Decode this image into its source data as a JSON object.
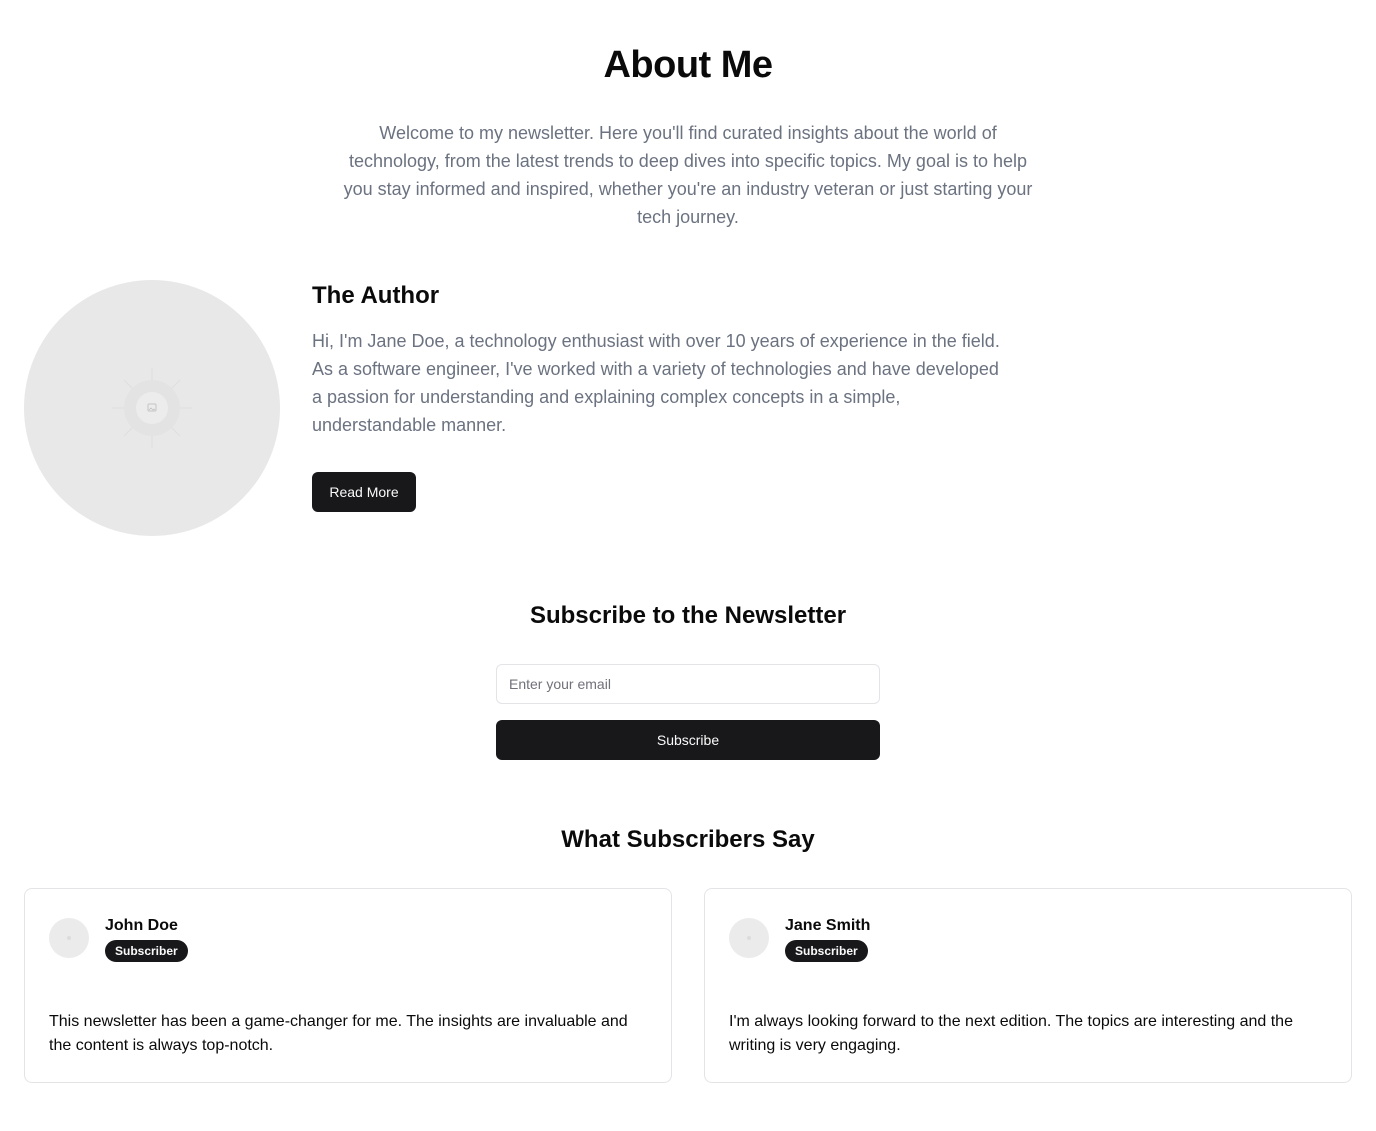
{
  "header": {
    "title": "About Me",
    "intro": "Welcome to my newsletter. Here you'll find curated insights about the world of technology, from the latest trends to deep dives into specific topics. My goal is to help you stay informed and inspired, whether you're an industry veteran or just starting your tech journey."
  },
  "author": {
    "heading": "The Author",
    "bio": "Hi, I'm Jane Doe, a technology enthusiast with over 10 years of experience in the field. As a software engineer, I've worked with a variety of technologies and have developed a passion for understanding and explaining complex concepts in a simple, understandable manner.",
    "read_more_label": "Read More",
    "avatar_icon": "image-placeholder-icon"
  },
  "subscribe": {
    "heading": "Subscribe to the Newsletter",
    "email_placeholder": "Enter your email",
    "email_value": "",
    "button_label": "Subscribe"
  },
  "testimonials": {
    "heading": "What Subscribers Say",
    "items": [
      {
        "name": "John Doe",
        "badge": "Subscriber",
        "quote": "This newsletter has been a game-changer for me. The insights are invaluable and the content is always top-notch."
      },
      {
        "name": "Jane Smith",
        "badge": "Subscriber",
        "quote": "I'm always looking forward to the next edition. The topics are interesting and the writing is very engaging."
      }
    ]
  },
  "colors": {
    "primary": "#18181b",
    "muted_text": "#6b7280",
    "border": "#e4e4e7",
    "placeholder_bg": "#e8e8e8"
  }
}
